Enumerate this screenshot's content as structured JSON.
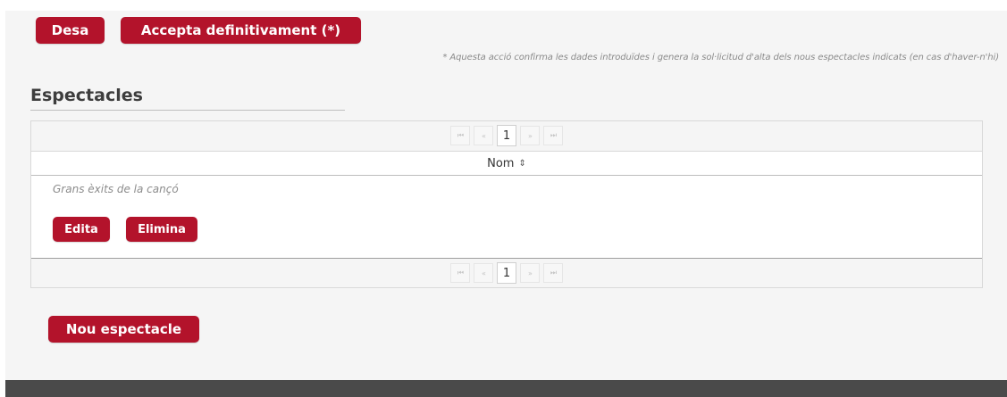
{
  "actions": {
    "save_label": "Desa",
    "accept_label": "Accepta definitivament (*)",
    "note": "* Aquesta acció confirma les dades introduïdes i genera la sol·licitud d'alta dels nous espectacles indicats (en cas d'haver-n'hi)"
  },
  "section": {
    "title": "Espectacles"
  },
  "table": {
    "column_header": "Nom",
    "sort_icon": "⇕",
    "paginator": {
      "first": "⏮",
      "prev": "«",
      "current_page": "1",
      "next": "»",
      "last": "⏭"
    },
    "rows": [
      {
        "name": "Grans èxits de la cançó",
        "edit_label": "Edita",
        "delete_label": "Elimina"
      }
    ]
  },
  "new_show_label": "Nou espectacle",
  "colors": {
    "accent": "#b3132b",
    "background": "#f5f5f5",
    "footer": "#4a4a4a"
  }
}
